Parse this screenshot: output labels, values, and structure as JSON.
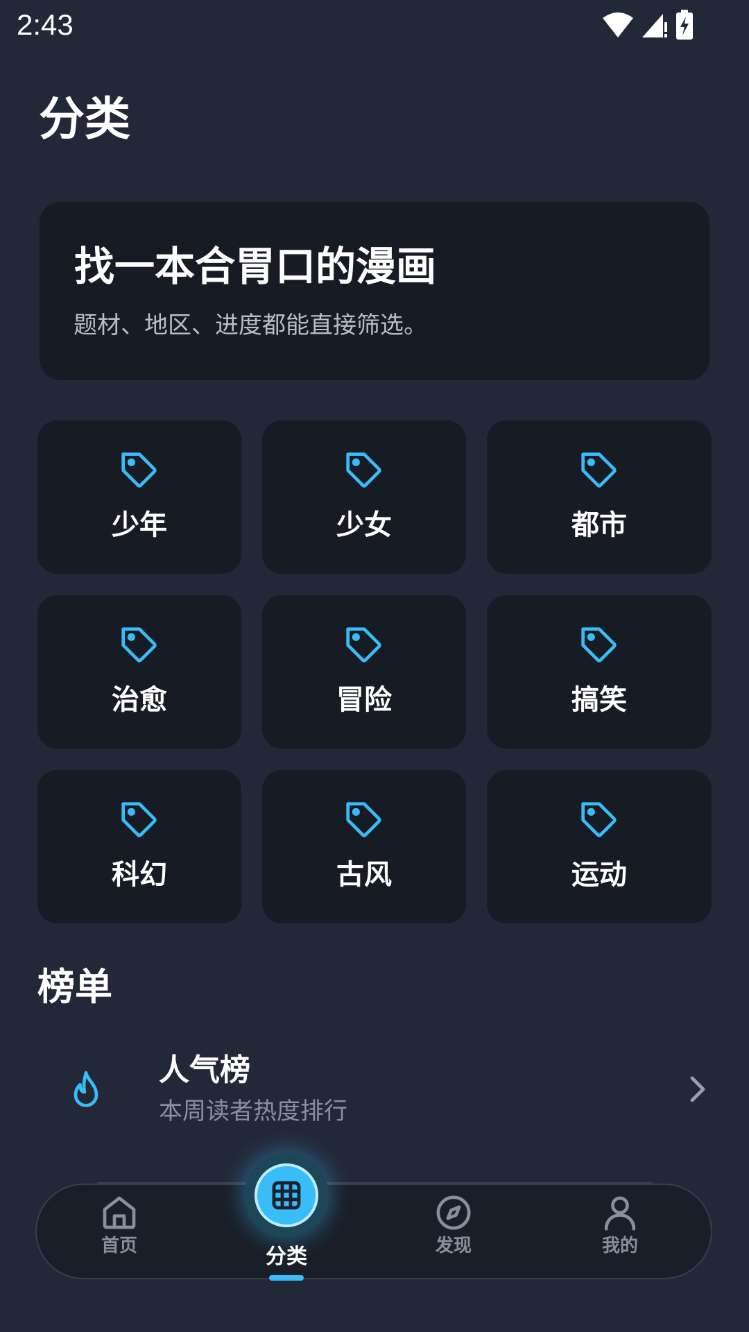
{
  "status_bar": {
    "time": "2:43"
  },
  "page": {
    "title": "分类"
  },
  "hero": {
    "title": "找一本合胃口的漫画",
    "subtitle": "题材、地区、进度都能直接筛选。"
  },
  "categories": [
    {
      "label": "少年",
      "icon": "tag-icon"
    },
    {
      "label": "少女",
      "icon": "tag-icon"
    },
    {
      "label": "都市",
      "icon": "tag-icon"
    },
    {
      "label": "治愈",
      "icon": "tag-icon"
    },
    {
      "label": "冒险",
      "icon": "tag-icon"
    },
    {
      "label": "搞笑",
      "icon": "tag-icon"
    },
    {
      "label": "科幻",
      "icon": "tag-icon"
    },
    {
      "label": "古风",
      "icon": "tag-icon"
    },
    {
      "label": "运动",
      "icon": "tag-icon"
    }
  ],
  "ranking": {
    "section_title": "榜单",
    "items": [
      {
        "title": "人气榜",
        "subtitle": "本周读者热度排行",
        "icon": "flame-icon"
      }
    ]
  },
  "bottom_nav": {
    "items": [
      {
        "label": "首页",
        "icon": "home-icon",
        "active": false
      },
      {
        "label": "分类",
        "icon": "grid-icon",
        "active": true
      },
      {
        "label": "发现",
        "icon": "compass-icon",
        "active": false
      },
      {
        "label": "我的",
        "icon": "person-icon",
        "active": false
      }
    ]
  },
  "colors": {
    "background": "#232838",
    "card": "#171b23",
    "accent": "#38bdf8",
    "muted_text": "#8b909c"
  }
}
